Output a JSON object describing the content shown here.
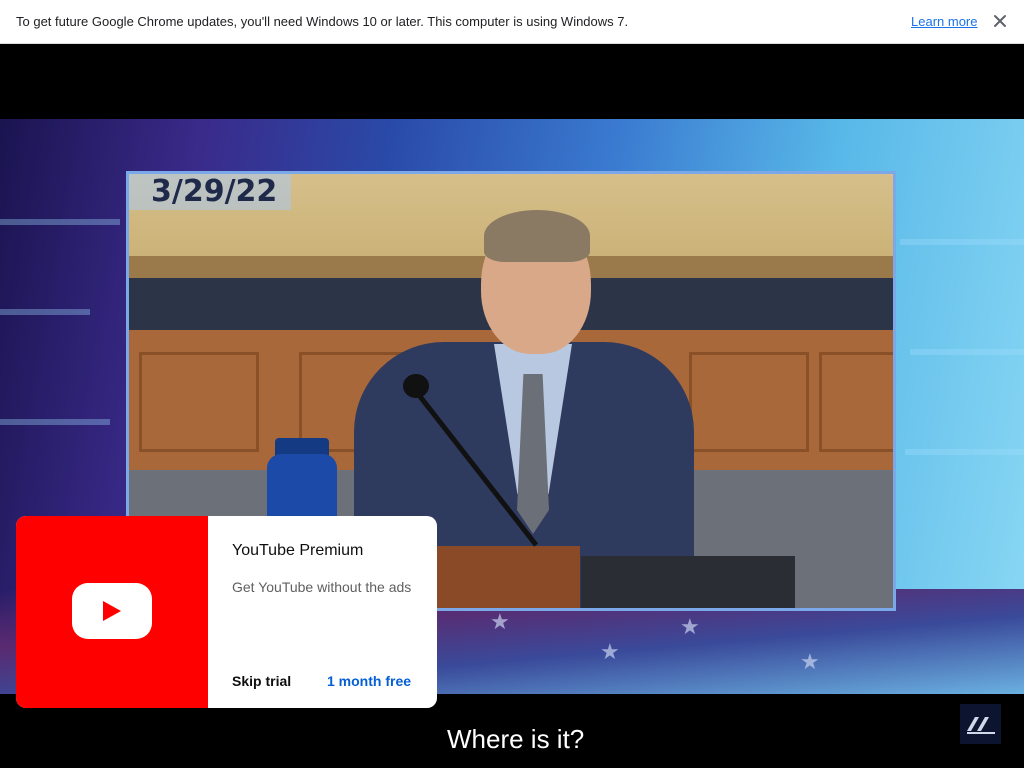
{
  "infobar": {
    "message": "To get future Google Chrome updates, you'll need Windows 10 or later. This computer is using Windows 7.",
    "learn_more": "Learn more",
    "close_icon": "close-icon"
  },
  "video": {
    "date_badge": "3/29/22",
    "caption": "Where is it?",
    "watermark_icon": "channel-watermark-icon"
  },
  "promo": {
    "logo_icon": "youtube-logo-icon",
    "title": "YouTube Premium",
    "subtitle": "Get YouTube without the ads",
    "skip_label": "Skip trial",
    "cta_label": "1 month free",
    "colors": {
      "brand_red": "#ff0000",
      "cta_blue": "#065fd4"
    }
  }
}
